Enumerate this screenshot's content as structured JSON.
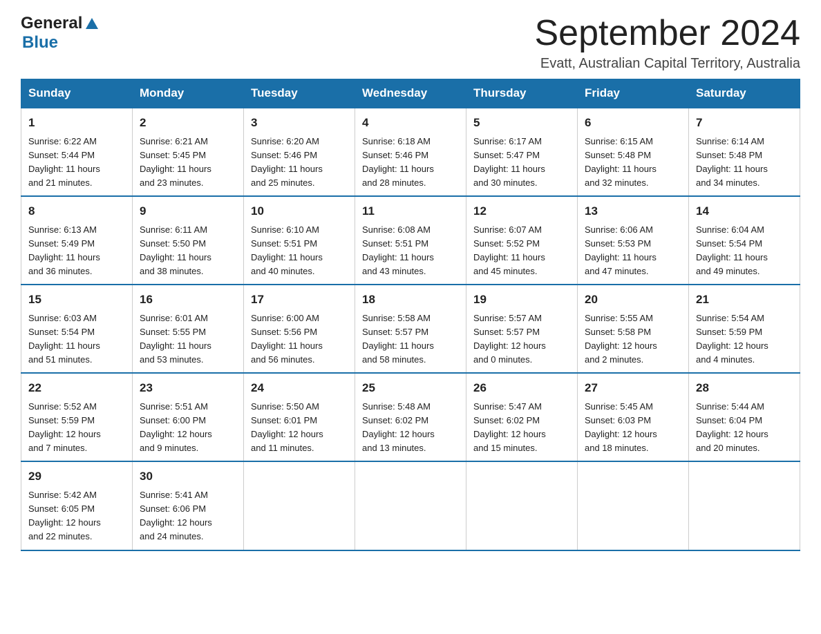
{
  "header": {
    "logo_text1": "General",
    "logo_text2": "Blue",
    "title": "September 2024",
    "subtitle": "Evatt, Australian Capital Territory, Australia"
  },
  "weekdays": [
    "Sunday",
    "Monday",
    "Tuesday",
    "Wednesday",
    "Thursday",
    "Friday",
    "Saturday"
  ],
  "weeks": [
    [
      {
        "day": "1",
        "sunrise": "6:22 AM",
        "sunset": "5:44 PM",
        "daylight": "11 hours and 21 minutes."
      },
      {
        "day": "2",
        "sunrise": "6:21 AM",
        "sunset": "5:45 PM",
        "daylight": "11 hours and 23 minutes."
      },
      {
        "day": "3",
        "sunrise": "6:20 AM",
        "sunset": "5:46 PM",
        "daylight": "11 hours and 25 minutes."
      },
      {
        "day": "4",
        "sunrise": "6:18 AM",
        "sunset": "5:46 PM",
        "daylight": "11 hours and 28 minutes."
      },
      {
        "day": "5",
        "sunrise": "6:17 AM",
        "sunset": "5:47 PM",
        "daylight": "11 hours and 30 minutes."
      },
      {
        "day": "6",
        "sunrise": "6:15 AM",
        "sunset": "5:48 PM",
        "daylight": "11 hours and 32 minutes."
      },
      {
        "day": "7",
        "sunrise": "6:14 AM",
        "sunset": "5:48 PM",
        "daylight": "11 hours and 34 minutes."
      }
    ],
    [
      {
        "day": "8",
        "sunrise": "6:13 AM",
        "sunset": "5:49 PM",
        "daylight": "11 hours and 36 minutes."
      },
      {
        "day": "9",
        "sunrise": "6:11 AM",
        "sunset": "5:50 PM",
        "daylight": "11 hours and 38 minutes."
      },
      {
        "day": "10",
        "sunrise": "6:10 AM",
        "sunset": "5:51 PM",
        "daylight": "11 hours and 40 minutes."
      },
      {
        "day": "11",
        "sunrise": "6:08 AM",
        "sunset": "5:51 PM",
        "daylight": "11 hours and 43 minutes."
      },
      {
        "day": "12",
        "sunrise": "6:07 AM",
        "sunset": "5:52 PM",
        "daylight": "11 hours and 45 minutes."
      },
      {
        "day": "13",
        "sunrise": "6:06 AM",
        "sunset": "5:53 PM",
        "daylight": "11 hours and 47 minutes."
      },
      {
        "day": "14",
        "sunrise": "6:04 AM",
        "sunset": "5:54 PM",
        "daylight": "11 hours and 49 minutes."
      }
    ],
    [
      {
        "day": "15",
        "sunrise": "6:03 AM",
        "sunset": "5:54 PM",
        "daylight": "11 hours and 51 minutes."
      },
      {
        "day": "16",
        "sunrise": "6:01 AM",
        "sunset": "5:55 PM",
        "daylight": "11 hours and 53 minutes."
      },
      {
        "day": "17",
        "sunrise": "6:00 AM",
        "sunset": "5:56 PM",
        "daylight": "11 hours and 56 minutes."
      },
      {
        "day": "18",
        "sunrise": "5:58 AM",
        "sunset": "5:57 PM",
        "daylight": "11 hours and 58 minutes."
      },
      {
        "day": "19",
        "sunrise": "5:57 AM",
        "sunset": "5:57 PM",
        "daylight": "12 hours and 0 minutes."
      },
      {
        "day": "20",
        "sunrise": "5:55 AM",
        "sunset": "5:58 PM",
        "daylight": "12 hours and 2 minutes."
      },
      {
        "day": "21",
        "sunrise": "5:54 AM",
        "sunset": "5:59 PM",
        "daylight": "12 hours and 4 minutes."
      }
    ],
    [
      {
        "day": "22",
        "sunrise": "5:52 AM",
        "sunset": "5:59 PM",
        "daylight": "12 hours and 7 minutes."
      },
      {
        "day": "23",
        "sunrise": "5:51 AM",
        "sunset": "6:00 PM",
        "daylight": "12 hours and 9 minutes."
      },
      {
        "day": "24",
        "sunrise": "5:50 AM",
        "sunset": "6:01 PM",
        "daylight": "12 hours and 11 minutes."
      },
      {
        "day": "25",
        "sunrise": "5:48 AM",
        "sunset": "6:02 PM",
        "daylight": "12 hours and 13 minutes."
      },
      {
        "day": "26",
        "sunrise": "5:47 AM",
        "sunset": "6:02 PM",
        "daylight": "12 hours and 15 minutes."
      },
      {
        "day": "27",
        "sunrise": "5:45 AM",
        "sunset": "6:03 PM",
        "daylight": "12 hours and 18 minutes."
      },
      {
        "day": "28",
        "sunrise": "5:44 AM",
        "sunset": "6:04 PM",
        "daylight": "12 hours and 20 minutes."
      }
    ],
    [
      {
        "day": "29",
        "sunrise": "5:42 AM",
        "sunset": "6:05 PM",
        "daylight": "12 hours and 22 minutes."
      },
      {
        "day": "30",
        "sunrise": "5:41 AM",
        "sunset": "6:06 PM",
        "daylight": "12 hours and 24 minutes."
      },
      null,
      null,
      null,
      null,
      null
    ]
  ],
  "labels": {
    "sunrise": "Sunrise:",
    "sunset": "Sunset:",
    "daylight": "Daylight:"
  },
  "colors": {
    "header_bg": "#1a6fa8",
    "accent": "#1a6fa8"
  }
}
